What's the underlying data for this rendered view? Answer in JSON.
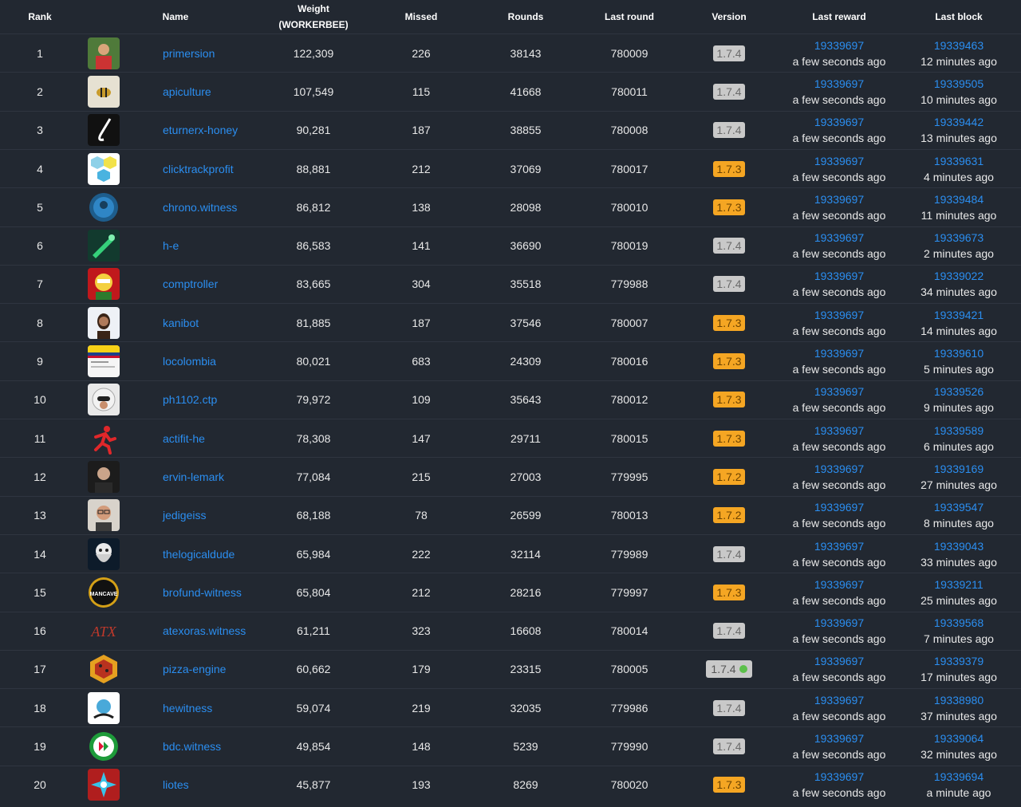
{
  "headers": {
    "rank": "Rank",
    "name": "Name",
    "weight_line1": "Weight",
    "weight_line2": "(WORKERBEE)",
    "missed": "Missed",
    "rounds": "Rounds",
    "last_round": "Last round",
    "version": "Version",
    "last_reward": "Last reward",
    "last_block": "Last block"
  },
  "rows": [
    {
      "rank": "1",
      "name": "primersion",
      "weight": "122,309",
      "missed": "226",
      "rounds": "38143",
      "last_round": "780009",
      "version": "1.7.4",
      "version_color": "grey",
      "reward_block": "19339697",
      "reward_ago": "a few seconds ago",
      "last_block": "19339463",
      "block_ago": "12 minutes ago",
      "avatar_icon": "person-photo-icon"
    },
    {
      "rank": "2",
      "name": "apiculture",
      "weight": "107,549",
      "missed": "115",
      "rounds": "41668",
      "last_round": "780011",
      "version": "1.7.4",
      "version_color": "grey",
      "reward_block": "19339697",
      "reward_ago": "a few seconds ago",
      "last_block": "19339505",
      "block_ago": "10 minutes ago",
      "avatar_icon": "bee-emblem-icon"
    },
    {
      "rank": "3",
      "name": "eturnerx-honey",
      "weight": "90,281",
      "missed": "187",
      "rounds": "38855",
      "last_round": "780008",
      "version": "1.7.4",
      "version_color": "grey",
      "reward_block": "19339697",
      "reward_ago": "a few seconds ago",
      "last_block": "19339442",
      "block_ago": "13 minutes ago",
      "avatar_icon": "hook-icon"
    },
    {
      "rank": "4",
      "name": "clicktrackprofit",
      "weight": "88,881",
      "missed": "212",
      "rounds": "37069",
      "last_round": "780017",
      "version": "1.7.3",
      "version_color": "orange",
      "reward_block": "19339697",
      "reward_ago": "a few seconds ago",
      "last_block": "19339631",
      "block_ago": "4 minutes ago",
      "avatar_icon": "hexagon-icons-icon"
    },
    {
      "rank": "5",
      "name": "chrono.witness",
      "weight": "86,812",
      "missed": "138",
      "rounds": "28098",
      "last_round": "780010",
      "version": "1.7.3",
      "version_color": "orange",
      "reward_block": "19339697",
      "reward_ago": "a few seconds ago",
      "last_block": "19339484",
      "block_ago": "11 minutes ago",
      "avatar_icon": "blue-seal-icon"
    },
    {
      "rank": "6",
      "name": "h-e",
      "weight": "86,583",
      "missed": "141",
      "rounds": "36690",
      "last_round": "780019",
      "version": "1.7.4",
      "version_color": "grey",
      "reward_block": "19339697",
      "reward_ago": "a few seconds ago",
      "last_block": "19339673",
      "block_ago": "2 minutes ago",
      "avatar_icon": "green-dragon-icon"
    },
    {
      "rank": "7",
      "name": "comptroller",
      "weight": "83,665",
      "missed": "304",
      "rounds": "35518",
      "last_round": "779988",
      "version": "1.7.4",
      "version_color": "grey",
      "reward_block": "19339697",
      "reward_ago": "a few seconds ago",
      "last_block": "19339022",
      "block_ago": "34 minutes ago",
      "avatar_icon": "cartoon-character-icon"
    },
    {
      "rank": "8",
      "name": "kanibot",
      "weight": "81,885",
      "missed": "187",
      "rounds": "37546",
      "last_round": "780007",
      "version": "1.7.3",
      "version_color": "orange",
      "reward_block": "19339697",
      "reward_ago": "a few seconds ago",
      "last_block": "19339421",
      "block_ago": "14 minutes ago",
      "avatar_icon": "woman-portrait-icon"
    },
    {
      "rank": "9",
      "name": "locolombia",
      "weight": "80,021",
      "missed": "683",
      "rounds": "24309",
      "last_round": "780016",
      "version": "1.7.3",
      "version_color": "orange",
      "reward_block": "19339697",
      "reward_ago": "a few seconds ago",
      "last_block": "19339610",
      "block_ago": "5 minutes ago",
      "avatar_icon": "colombia-flag-icon"
    },
    {
      "rank": "10",
      "name": "ph1102.ctp",
      "weight": "79,972",
      "missed": "109",
      "rounds": "35643",
      "last_round": "780012",
      "version": "1.7.3",
      "version_color": "orange",
      "reward_block": "19339697",
      "reward_ago": "a few seconds ago",
      "last_block": "19339526",
      "block_ago": "9 minutes ago",
      "avatar_icon": "hooded-face-icon"
    },
    {
      "rank": "11",
      "name": "actifit-he",
      "weight": "78,308",
      "missed": "147",
      "rounds": "29711",
      "last_round": "780015",
      "version": "1.7.3",
      "version_color": "orange",
      "reward_block": "19339697",
      "reward_ago": "a few seconds ago",
      "last_block": "19339589",
      "block_ago": "6 minutes ago",
      "avatar_icon": "runner-icon"
    },
    {
      "rank": "12",
      "name": "ervin-lemark",
      "weight": "77,084",
      "missed": "215",
      "rounds": "27003",
      "last_round": "779995",
      "version": "1.7.2",
      "version_color": "orange",
      "reward_block": "19339697",
      "reward_ago": "a few seconds ago",
      "last_block": "19339169",
      "block_ago": "27 minutes ago",
      "avatar_icon": "man-portrait-icon"
    },
    {
      "rank": "13",
      "name": "jedigeiss",
      "weight": "68,188",
      "missed": "78",
      "rounds": "26599",
      "last_round": "780013",
      "version": "1.7.2",
      "version_color": "orange",
      "reward_block": "19339697",
      "reward_ago": "a few seconds ago",
      "last_block": "19339547",
      "block_ago": "8 minutes ago",
      "avatar_icon": "man-glasses-icon"
    },
    {
      "rank": "14",
      "name": "thelogicaldude",
      "weight": "65,984",
      "missed": "222",
      "rounds": "32114",
      "last_round": "779989",
      "version": "1.7.4",
      "version_color": "grey",
      "reward_block": "19339697",
      "reward_ago": "a few seconds ago",
      "last_block": "19339043",
      "block_ago": "33 minutes ago",
      "avatar_icon": "bearded-skull-icon"
    },
    {
      "rank": "15",
      "name": "brofund-witness",
      "weight": "65,804",
      "missed": "212",
      "rounds": "28216",
      "last_round": "779997",
      "version": "1.7.3",
      "version_color": "orange",
      "reward_block": "19339697",
      "reward_ago": "a few seconds ago",
      "last_block": "19339211",
      "block_ago": "25 minutes ago",
      "avatar_icon": "mancave-badge-icon",
      "avatar_text": "MANCAVE"
    },
    {
      "rank": "16",
      "name": "atexoras.witness",
      "weight": "61,211",
      "missed": "323",
      "rounds": "16608",
      "last_round": "780014",
      "version": "1.7.4",
      "version_color": "grey",
      "reward_block": "19339697",
      "reward_ago": "a few seconds ago",
      "last_block": "19339568",
      "block_ago": "7 minutes ago",
      "avatar_icon": "atx-logo-icon",
      "avatar_text": "ATX"
    },
    {
      "rank": "17",
      "name": "pizza-engine",
      "weight": "60,662",
      "missed": "179",
      "rounds": "23315",
      "last_round": "780005",
      "version": "1.7.4",
      "version_color": "grey-dot",
      "reward_block": "19339697",
      "reward_ago": "a few seconds ago",
      "last_block": "19339379",
      "block_ago": "17 minutes ago",
      "avatar_icon": "pizza-hexagon-icon"
    },
    {
      "rank": "18",
      "name": "hewitness",
      "weight": "59,074",
      "missed": "219",
      "rounds": "32035",
      "last_round": "779986",
      "version": "1.7.4",
      "version_color": "grey",
      "reward_block": "19339697",
      "reward_ago": "a few seconds ago",
      "last_block": "19338980",
      "block_ago": "37 minutes ago",
      "avatar_icon": "mascot-icon"
    },
    {
      "rank": "19",
      "name": "bdc.witness",
      "weight": "49,854",
      "missed": "148",
      "rounds": "5239",
      "last_round": "779990",
      "version": "1.7.4",
      "version_color": "grey",
      "reward_block": "19339697",
      "reward_ago": "a few seconds ago",
      "last_block": "19339064",
      "block_ago": "32 minutes ago",
      "avatar_icon": "green-ring-icon"
    },
    {
      "rank": "20",
      "name": "liotes",
      "weight": "45,877",
      "missed": "193",
      "rounds": "8269",
      "last_round": "780020",
      "version": "1.7.3",
      "version_color": "orange",
      "reward_block": "19339697",
      "reward_ago": "a few seconds ago",
      "last_block": "19339694",
      "block_ago": "a minute ago",
      "avatar_icon": "star-burst-icon"
    }
  ],
  "colors": {
    "background": "#222831",
    "link": "#2b8ef0",
    "badge_grey": "#c9c9c9",
    "badge_orange": "#f5a623",
    "status_dot": "#5cc04b"
  }
}
